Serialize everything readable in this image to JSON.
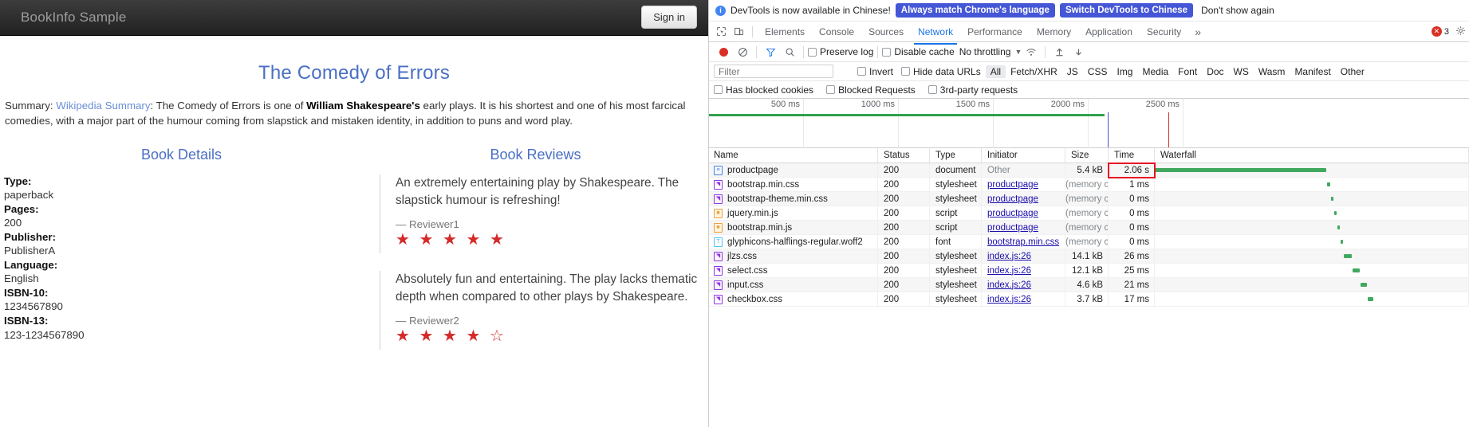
{
  "bookinfo": {
    "brand": "BookInfo Sample",
    "signin_label": "Sign in",
    "title": "The Comedy of Errors",
    "summary_prefix": "Summary: ",
    "summary_link": "Wikipedia Summary",
    "summary_mid": ": The Comedy of Errors is one of ",
    "summary_bold": "William Shakespeare's",
    "summary_rest": " early plays. It is his shortest and one of his most farcical comedies, with a major part of the humour coming from slapstick and mistaken identity, in addition to puns and word play.",
    "details_heading": "Book Details",
    "reviews_heading": "Book Reviews",
    "details": [
      {
        "label": "Type:",
        "value": "paperback"
      },
      {
        "label": "Pages:",
        "value": "200"
      },
      {
        "label": "Publisher:",
        "value": "PublisherA"
      },
      {
        "label": "Language:",
        "value": "English"
      },
      {
        "label": "ISBN-10:",
        "value": "1234567890"
      },
      {
        "label": "ISBN-13:",
        "value": "123-1234567890"
      }
    ],
    "reviews": [
      {
        "text": "An extremely entertaining play by Shakespeare. The slapstick humour is refreshing!",
        "author": "— Reviewer1",
        "stars": "★ ★ ★ ★ ★",
        "rating": 5
      },
      {
        "text": "Absolutely fun and entertaining. The play lacks thematic depth when compared to other plays by Shakespeare.",
        "author": "— Reviewer2",
        "stars": "★ ★ ★ ★ ☆",
        "rating": 4
      }
    ]
  },
  "devtools": {
    "banner": {
      "message": "DevTools is now available in Chinese!",
      "primary_btn": "Always match Chrome's language",
      "secondary_btn": "Switch DevTools to Chinese",
      "dismiss": "Don't show again",
      "info_icon": "info-icon",
      "primary_color": "#4557d6"
    },
    "tabs": [
      {
        "label": "Elements",
        "active": false
      },
      {
        "label": "Console",
        "active": false
      },
      {
        "label": "Sources",
        "active": false
      },
      {
        "label": "Network",
        "active": true
      },
      {
        "label": "Performance",
        "active": false
      },
      {
        "label": "Memory",
        "active": false
      },
      {
        "label": "Application",
        "active": false
      },
      {
        "label": "Security",
        "active": false
      }
    ],
    "more_tabs": "»",
    "error_count": "3",
    "toolbar": {
      "record_title": "record-button",
      "clear_title": "clear-button",
      "filter_title": "filter-toggle",
      "search_title": "search-button",
      "preserve_log": "Preserve log",
      "disable_cache": "Disable cache",
      "throttling": "No throttling",
      "import_title": "import-har",
      "export_title": "export-har"
    },
    "filter": {
      "placeholder": "Filter",
      "value": "",
      "invert": "Invert",
      "hide_data_urls": "Hide data URLs",
      "types": [
        "All",
        "Fetch/XHR",
        "JS",
        "CSS",
        "Img",
        "Media",
        "Font",
        "Doc",
        "WS",
        "Wasm",
        "Manifest",
        "Other"
      ],
      "selected_type": "All",
      "has_blocked_cookies": "Has blocked cookies",
      "blocked_requests": "Blocked Requests",
      "third_party": "3rd-party requests"
    },
    "overview": {
      "ticks": [
        "500 ms",
        "1000 ms",
        "1500 ms",
        "2000 ms",
        "2500 ms"
      ]
    },
    "table": {
      "columns": [
        "Name",
        "Status",
        "Type",
        "Initiator",
        "Size",
        "Time",
        "Waterfall"
      ],
      "rows": [
        {
          "name": "productpage",
          "icon": "document-icon",
          "status": "200",
          "type": "document",
          "initiator": "Other",
          "initiator_link": false,
          "size": "5.4 kB",
          "time": "2.06 s",
          "highlight": true
        },
        {
          "name": "bootstrap.min.css",
          "icon": "stylesheet-icon",
          "status": "200",
          "type": "stylesheet",
          "initiator": "productpage",
          "initiator_link": true,
          "size": "(memory c…",
          "time": "1 ms",
          "highlight": false
        },
        {
          "name": "bootstrap-theme.min.css",
          "icon": "stylesheet-icon",
          "status": "200",
          "type": "stylesheet",
          "initiator": "productpage",
          "initiator_link": true,
          "size": "(memory c…",
          "time": "0 ms",
          "highlight": false
        },
        {
          "name": "jquery.min.js",
          "icon": "script-icon",
          "status": "200",
          "type": "script",
          "initiator": "productpage",
          "initiator_link": true,
          "size": "(memory c…",
          "time": "0 ms",
          "highlight": false
        },
        {
          "name": "bootstrap.min.js",
          "icon": "script-icon",
          "status": "200",
          "type": "script",
          "initiator": "productpage",
          "initiator_link": true,
          "size": "(memory c…",
          "time": "0 ms",
          "highlight": false
        },
        {
          "name": "glyphicons-halflings-regular.woff2",
          "icon": "font-icon",
          "status": "200",
          "type": "font",
          "initiator": "bootstrap.min.css",
          "initiator_link": true,
          "size": "(memory c…",
          "time": "0 ms",
          "highlight": false
        },
        {
          "name": "jlzs.css",
          "icon": "stylesheet-icon",
          "status": "200",
          "type": "stylesheet",
          "initiator": "index.js:26",
          "initiator_link": true,
          "size": "14.1 kB",
          "time": "26 ms",
          "highlight": false
        },
        {
          "name": "select.css",
          "icon": "stylesheet-icon",
          "status": "200",
          "type": "stylesheet",
          "initiator": "index.js:26",
          "initiator_link": true,
          "size": "12.1 kB",
          "time": "25 ms",
          "highlight": false
        },
        {
          "name": "input.css",
          "icon": "stylesheet-icon",
          "status": "200",
          "type": "stylesheet",
          "initiator": "index.js:26",
          "initiator_link": true,
          "size": "4.6 kB",
          "time": "21 ms",
          "highlight": false
        },
        {
          "name": "checkbox.css",
          "icon": "stylesheet-icon",
          "status": "200",
          "type": "stylesheet",
          "initiator": "index.js:26",
          "initiator_link": true,
          "size": "3.7 kB",
          "time": "17 ms",
          "highlight": false
        }
      ]
    }
  }
}
